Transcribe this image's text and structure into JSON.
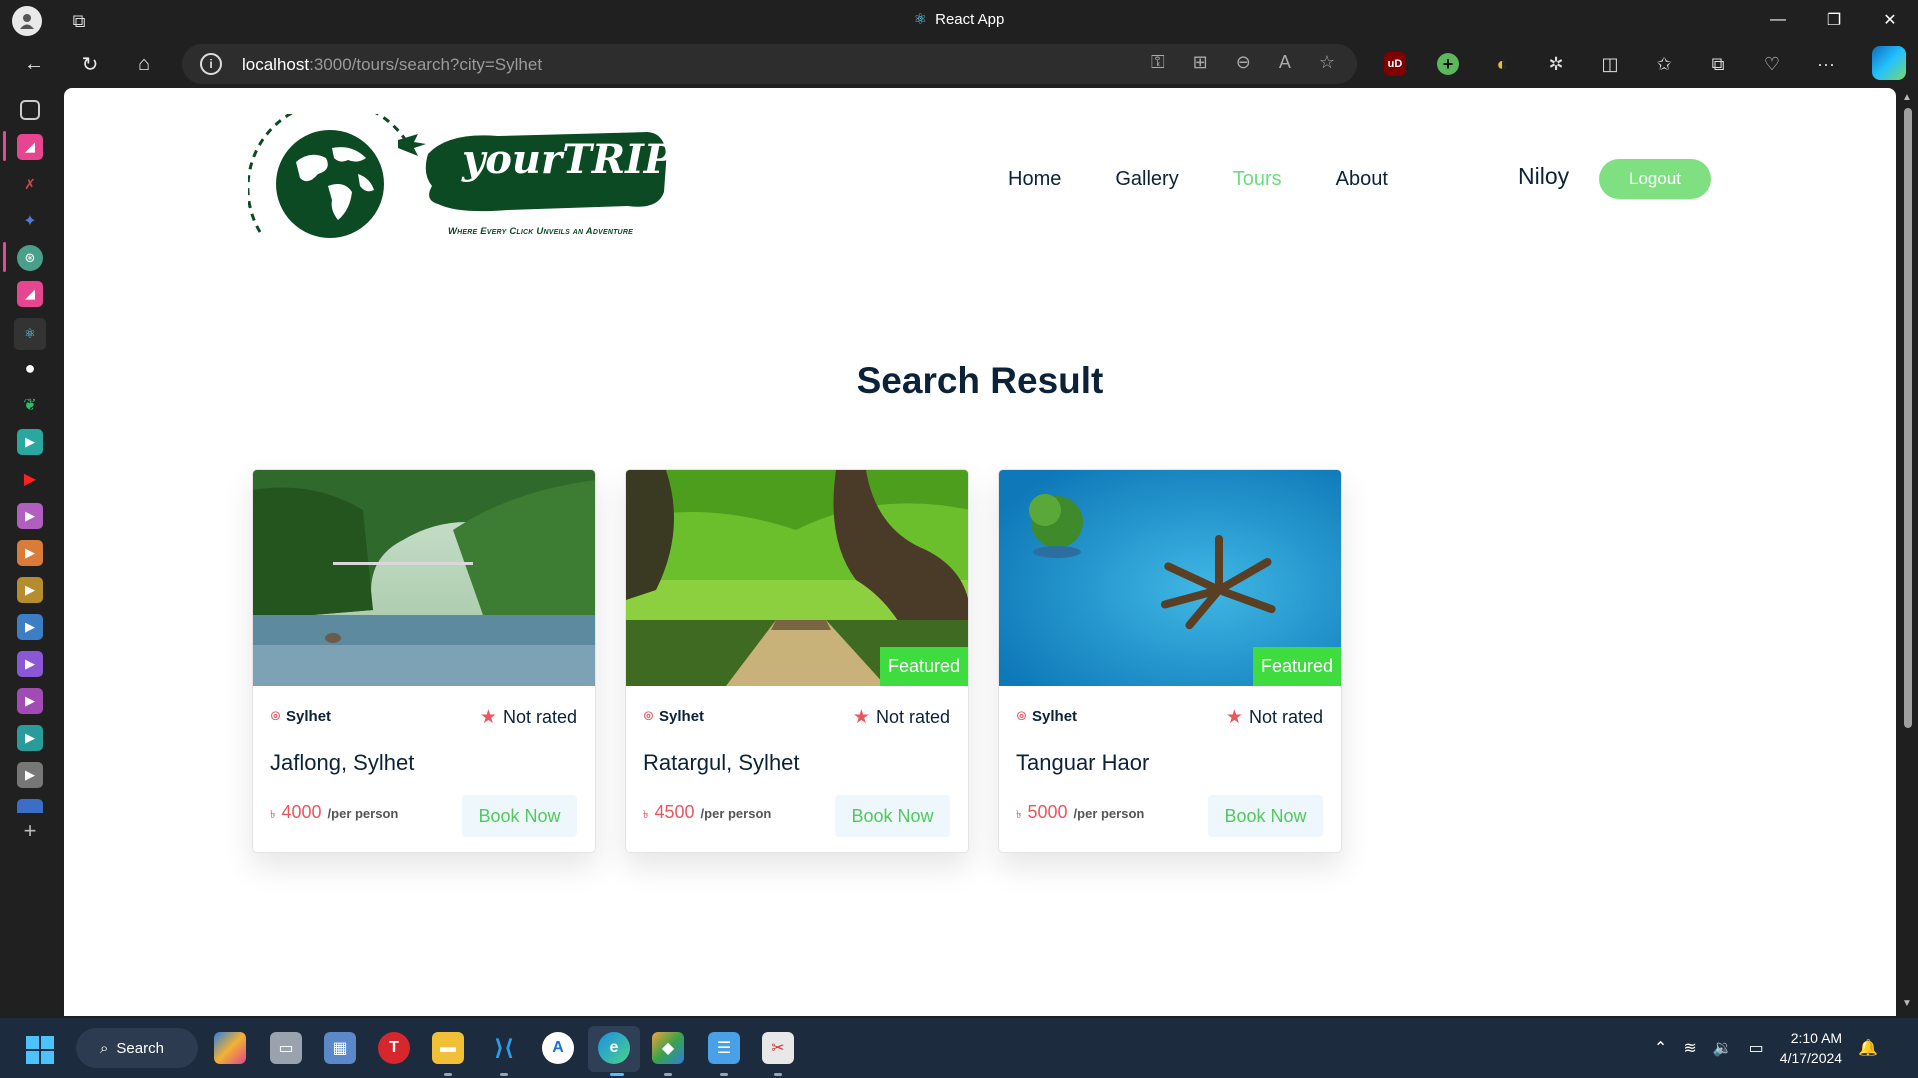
{
  "browser": {
    "window_title": "React App",
    "url_host": "localhost",
    "url_rest": ":3000/tours/search?city=Sylhet"
  },
  "site": {
    "brand": "yourTRIP",
    "tagline": "Where Every Click Unveils an Adventure",
    "nav": [
      {
        "label": "Home",
        "active": false
      },
      {
        "label": "Gallery",
        "active": false
      },
      {
        "label": "Tours",
        "active": true
      },
      {
        "label": "About",
        "active": false
      }
    ],
    "user": "Niloy",
    "logout_label": "Logout",
    "accent_color": "#7ee081"
  },
  "results": {
    "title": "Search Result",
    "cards": [
      {
        "city": "Sylhet",
        "rating": "Not rated",
        "name": "Jaflong, Sylhet",
        "currency": "৳",
        "price": "4000",
        "per": "/per person",
        "book_label": "Book Now",
        "featured": ""
      },
      {
        "city": "Sylhet",
        "rating": "Not rated",
        "name": "Ratargul, Sylhet",
        "currency": "৳",
        "price": "4500",
        "per": "/per person",
        "book_label": "Book Now",
        "featured": "Featured"
      },
      {
        "city": "Sylhet",
        "rating": "Not rated",
        "name": "Tanguar Haor",
        "currency": "৳",
        "price": "5000",
        "per": "/per person",
        "book_label": "Book Now",
        "featured": "Featured"
      }
    ]
  },
  "taskbar": {
    "search_label": "Search",
    "time": "2:10 AM",
    "date": "4/17/2024"
  }
}
